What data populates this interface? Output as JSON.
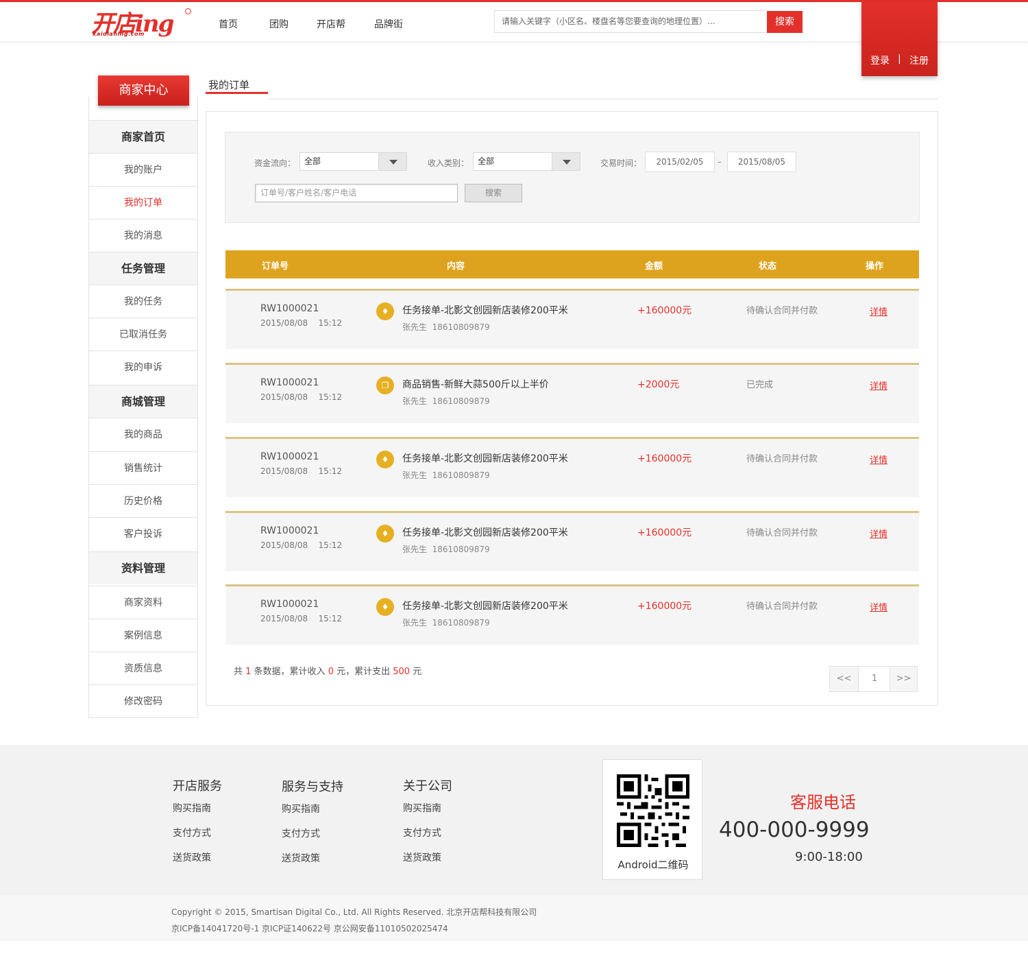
{
  "header": {
    "logo_text": "开店ing",
    "logo_sub": "kaidianing.com",
    "logo_tm": "TM",
    "nav": [
      "首页",
      "团购",
      "开店帮",
      "品牌街"
    ],
    "search_placeholder": "请输入关键字（小区名、楼盘名等您要查询的地理位置）...",
    "search_button": "搜索",
    "login": "登录",
    "separator": "|",
    "register": "注册"
  },
  "sidebar": {
    "title": "商家中心",
    "groups": [
      {
        "label": "商家首页",
        "items": [
          "我的账户",
          "我的订单",
          "我的消息"
        ]
      },
      {
        "label": "任务管理",
        "items": [
          "我的任务",
          "已取消任务",
          "我的申诉"
        ]
      },
      {
        "label": "商城管理",
        "items": [
          "我的商品",
          "销售统计",
          "历史价格",
          "客户投诉"
        ]
      },
      {
        "label": "资料管理",
        "items": [
          "商家资料",
          "案例信息",
          "资质信息",
          "修改密码"
        ]
      }
    ],
    "active_item": "我的订单"
  },
  "page": {
    "title": "我的订单"
  },
  "filter": {
    "flow_label": "资金流向：",
    "flow_value": "全部",
    "income_label": "收入类别：",
    "income_value": "全部",
    "time_label": "交易时间：",
    "date_from": "2015/02/05",
    "date_sep": "–",
    "date_to": "2015/08/05",
    "keyword_placeholder": "订单号/客户姓名/客户电话",
    "search_button": "搜索"
  },
  "table": {
    "headers": [
      "订单号",
      "内容",
      "金额",
      "状态",
      "操作"
    ],
    "rows": [
      {
        "id": "RW1000021",
        "date": "2015/08/08",
        "time": "15:12",
        "icon": "tag-icon",
        "title": "任务接单-北影文创园新店装修200平米",
        "customer": "张先生",
        "phone": "18610809879",
        "amount": "+160000元",
        "status": "待确认合同并付款",
        "action": "详情"
      },
      {
        "id": "RW1000021",
        "date": "2015/08/08",
        "time": "15:12",
        "icon": "goods-icon",
        "title": "商品销售-新鲜大蒜500斤以上半价",
        "customer": "张先生",
        "phone": "18610809879",
        "amount": "+2000元",
        "status": "已完成",
        "action": "详情"
      },
      {
        "id": "RW1000021",
        "date": "2015/08/08",
        "time": "15:12",
        "icon": "tag-icon",
        "title": "任务接单-北影文创园新店装修200平米",
        "customer": "张先生",
        "phone": "18610809879",
        "amount": "+160000元",
        "status": "待确认合同并付款",
        "action": "详情"
      },
      {
        "id": "RW1000021",
        "date": "2015/08/08",
        "time": "15:12",
        "icon": "tag-icon",
        "title": "任务接单-北影文创园新店装修200平米",
        "customer": "张先生",
        "phone": "18610809879",
        "amount": "+160000元",
        "status": "待确认合同并付款",
        "action": "详情"
      },
      {
        "id": "RW1000021",
        "date": "2015/08/08",
        "time": "15:12",
        "icon": "tag-icon",
        "title": "任务接单-北影文创园新店装修200平米",
        "customer": "张先生",
        "phone": "18610809879",
        "amount": "+160000元",
        "status": "待确认合同并付款",
        "action": "详情"
      }
    ]
  },
  "summary": {
    "p1": "共 ",
    "count": "1",
    "p2": " 条数据，累计收入 ",
    "income": "0",
    "p3": " 元，累计支出 ",
    "expense": "500",
    "p4": " 元"
  },
  "pager": {
    "prev": "<<",
    "current": "1",
    "next": ">>"
  },
  "footer": {
    "columns": [
      {
        "title": "开店服务",
        "items": [
          "购买指南",
          "支付方式",
          "送货政策"
        ]
      },
      {
        "title": "服务与支持",
        "items": [
          "购买指南",
          "支付方式",
          "送货政策"
        ]
      },
      {
        "title": "关于公司",
        "items": [
          "购买指南",
          "支付方式",
          "送货政策"
        ]
      }
    ],
    "qr_label": "Android二维码",
    "hotline_label": "客服电话",
    "hotline": "400-000-9999",
    "hours": "9:00-18:00",
    "copyright": "Copyright © 2015, Smartisan Digital Co., Ltd. All Rights Reserved. 北京开店帮科技有限公司",
    "icp": "京ICP备14041720号-1 京ICP证140622号 京公网安备11010502025474"
  },
  "colors": {
    "brand_red": "#e4302a",
    "table_header": "#dea31e",
    "row_border": "#d9c582",
    "icon_yellow": "#e6b022"
  }
}
